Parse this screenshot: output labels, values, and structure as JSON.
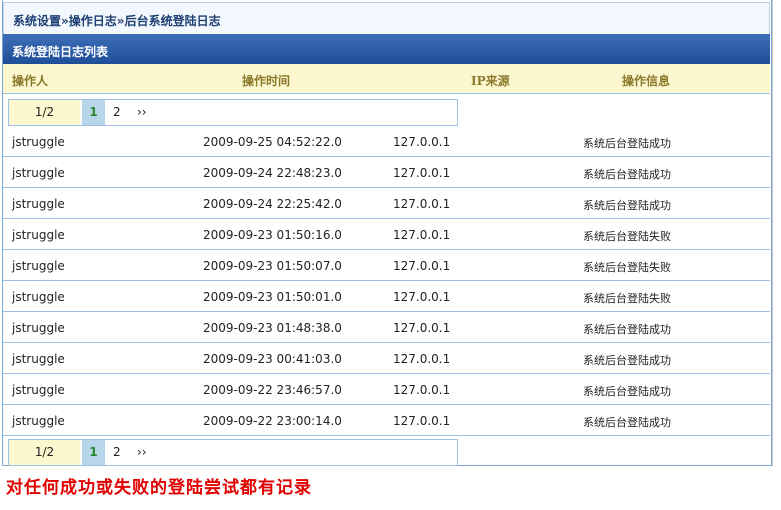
{
  "breadcrumb": {
    "item1": "系统设置",
    "sep1": "»",
    "item2": "操作日志",
    "sep2": "»",
    "item3": "后台系统登陆日志"
  },
  "list_title": "系统登陆日志列表",
  "columns": {
    "operator": "操作人",
    "time": "操作时间",
    "ip": "IP来源",
    "info": "操作信息"
  },
  "pager": {
    "position": "1/2",
    "current_page": "1",
    "next_page": "2",
    "next_symbol": "››"
  },
  "rows": [
    {
      "user": "jstruggle",
      "time": "2009-09-25 04:52:22.0",
      "ip": "127.0.0.1",
      "info": "系统后台登陆成功"
    },
    {
      "user": "jstruggle",
      "time": "2009-09-24 22:48:23.0",
      "ip": "127.0.0.1",
      "info": "系统后台登陆成功"
    },
    {
      "user": "jstruggle",
      "time": "2009-09-24 22:25:42.0",
      "ip": "127.0.0.1",
      "info": "系统后台登陆成功"
    },
    {
      "user": "jstruggle",
      "time": "2009-09-23 01:50:16.0",
      "ip": "127.0.0.1",
      "info": "系统后台登陆失败"
    },
    {
      "user": "jstruggle",
      "time": "2009-09-23 01:50:07.0",
      "ip": "127.0.0.1",
      "info": "系统后台登陆失败"
    },
    {
      "user": "jstruggle",
      "time": "2009-09-23 01:50:01.0",
      "ip": "127.0.0.1",
      "info": "系统后台登陆失败"
    },
    {
      "user": "jstruggle",
      "time": "2009-09-23 01:48:38.0",
      "ip": "127.0.0.1",
      "info": "系统后台登陆成功"
    },
    {
      "user": "jstruggle",
      "time": "2009-09-23 00:41:03.0",
      "ip": "127.0.0.1",
      "info": "系统后台登陆成功"
    },
    {
      "user": "jstruggle",
      "time": "2009-09-22 23:46:57.0",
      "ip": "127.0.0.1",
      "info": "系统后台登陆成功"
    },
    {
      "user": "jstruggle",
      "time": "2009-09-22 23:00:14.0",
      "ip": "127.0.0.1",
      "info": "系统后台登陆成功"
    }
  ],
  "caption": "对任何成功或失败的登陆尝试都有记录",
  "colors": {
    "header_bar": "#1e4e97",
    "column_header_bg": "#fdf7cf",
    "current_page_bg": "#b7d6ea",
    "caption_red": "#e00000"
  }
}
